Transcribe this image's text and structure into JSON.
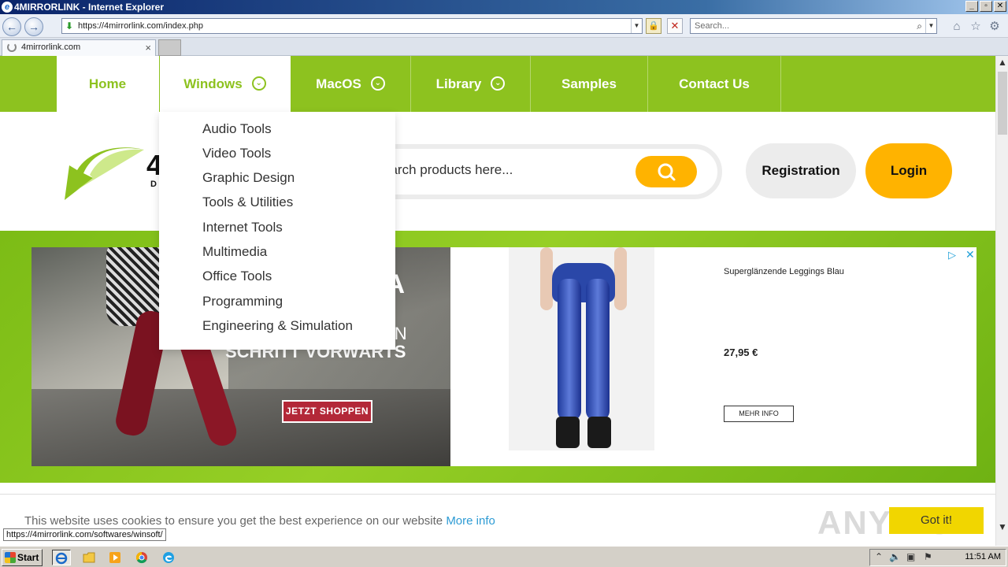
{
  "window": {
    "title": "4MIRRORLINK - Internet Explorer",
    "ie_letter": "e",
    "min": "_",
    "restore": "▫",
    "close": "✕"
  },
  "browser": {
    "back_glyph": "←",
    "forward_glyph": "→",
    "address_icon": "⬇",
    "address": "https://4mirrorlink.com/index.php",
    "address_dropdown": "▼",
    "lock_glyph": "🔒",
    "stop_glyph": "✕",
    "search_placeholder": "Search...",
    "search_glyph": "⌕",
    "search_dropdown": "▼",
    "home_glyph": "⌂",
    "fav_glyph": "☆",
    "tools_glyph": "⚙",
    "tab_title": "4mirrorlink.com",
    "tab_close": "×"
  },
  "nav": {
    "items": [
      {
        "label": "Home",
        "active": false,
        "has_menu": false
      },
      {
        "label": "Windows",
        "active": true,
        "has_menu": true
      },
      {
        "label": "MacOS",
        "active": false,
        "has_menu": true
      },
      {
        "label": "Library",
        "active": false,
        "has_menu": true
      },
      {
        "label": "Samples",
        "active": false,
        "has_menu": false
      },
      {
        "label": "Contact Us",
        "active": false,
        "has_menu": false
      }
    ],
    "chevron": "⌄"
  },
  "header": {
    "logo_text": "4",
    "logo_sub": "D",
    "search_placeholder": "earch products here...",
    "search_icon": "search-icon",
    "registration": "Registration",
    "login": "Login"
  },
  "dropdown": {
    "items": [
      "Audio Tools",
      "Video Tools",
      "Graphic Design",
      "Tools & Utilities",
      "Internet Tools",
      "Multimedia",
      "Office Tools",
      "Programming",
      "Engineering & Simulation"
    ]
  },
  "ad": {
    "headline": "IA",
    "line1": "EIN",
    "line2": "SCHRITT VORWÄRTS",
    "cta": "JETZT SHOPPEN",
    "product_title": "Superglänzende Leggings Blau",
    "price": "27,95 €",
    "more": "MEHR INFO",
    "choices_glyph": "▷",
    "close_glyph": "✕"
  },
  "cookie": {
    "message": "This website uses cookies to ensure you get the best experience on our website",
    "more_info": "More info",
    "button": "Got it!",
    "watermark": "ANY RUN"
  },
  "status_url": "https://4mirrorlink.com/softwares/winsoft/",
  "scrollbar": {
    "up": "▲",
    "down": "▼"
  },
  "taskbar": {
    "start": "Start",
    "clock": "11:51 AM",
    "quick_launch": [
      "ie-icon",
      "folder-icon",
      "media-player-icon",
      "chrome-icon",
      "edge-icon"
    ]
  },
  "colors": {
    "brand_green": "#8dc21f",
    "accent_yellow": "#ffb300",
    "cookie_button": "#f1d600",
    "link_blue": "#2d9bd4"
  }
}
